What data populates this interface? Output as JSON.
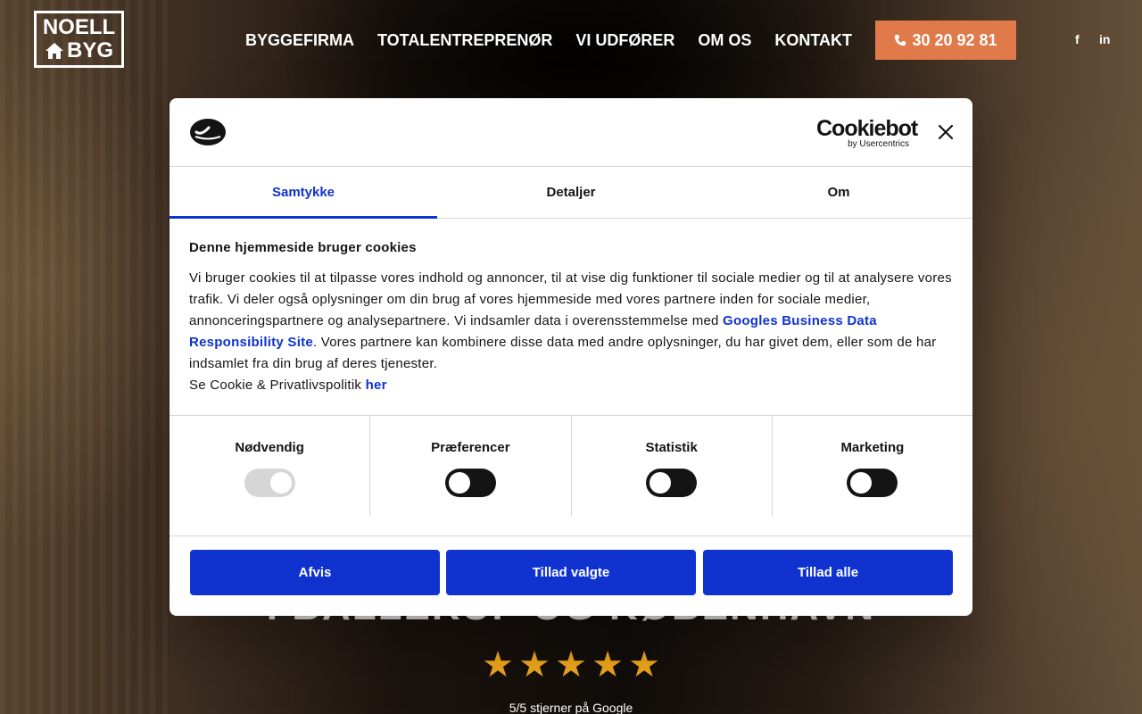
{
  "header": {
    "logo": {
      "line1": "NOELL",
      "line2": "BYG"
    },
    "nav": [
      "BYGGEFIRMA",
      "TOTALENTREPRENØR",
      "VI UDFØRER",
      "OM OS",
      "KONTAKT"
    ],
    "phone": "30 20 92 81",
    "social": {
      "facebook": "f",
      "linkedin": "in"
    }
  },
  "hero": {
    "title": "I BALLERUP OG KØBENHAVN",
    "stars": 5,
    "rating_text": "5/5 stjerner på Google"
  },
  "dialog": {
    "brand": {
      "name": "Cookiebot",
      "sub": "by Usercentrics"
    },
    "tabs": [
      "Samtykke",
      "Detaljer",
      "Om"
    ],
    "heading": "Denne hjemmeside bruger cookies",
    "text_part1": "Vi bruger cookies til at tilpasse vores indhold og annoncer, til at vise dig funktioner til sociale medier og til at analysere vores trafik. Vi deler også oplysninger om din brug af vores hjemmeside med vores partnere inden for sociale medier, annonceringspartnere og analysepartnere. Vi indsamler data i overensstemmelse med ",
    "link_google": "Googles Business Data Responsibility Site",
    "text_part2": ". Vores partnere kan kombinere disse data med andre oplysninger, du har givet dem, eller som de har indsamlet fra din brug af deres tjenester.",
    "policy_text": "Se Cookie & Privatlivspolitik ",
    "policy_link": "her",
    "toggles": [
      {
        "label": "Nødvendig",
        "state": "on-disabled"
      },
      {
        "label": "Præferencer",
        "state": "off"
      },
      {
        "label": "Statistik",
        "state": "off"
      },
      {
        "label": "Marketing",
        "state": "off"
      }
    ],
    "buttons": {
      "deny": "Afvis",
      "allow_selected": "Tillad valgte",
      "allow_all": "Tillad alle"
    }
  }
}
